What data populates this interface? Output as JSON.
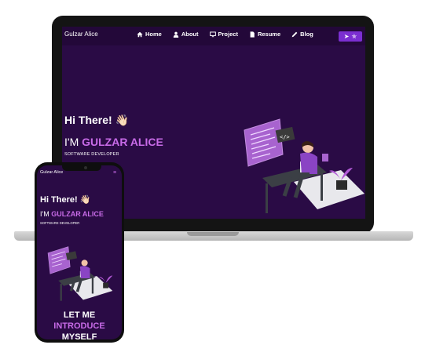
{
  "laptop": {
    "brand": "Gulzar Alice",
    "nav": [
      {
        "label": "Home",
        "icon": "home-icon"
      },
      {
        "label": "About",
        "icon": "person-icon"
      },
      {
        "label": "Project",
        "icon": "monitor-icon"
      },
      {
        "label": "Resume",
        "icon": "document-icon"
      },
      {
        "label": "Blog",
        "icon": "pen-icon"
      }
    ],
    "toggle_icons": [
      "send-icon",
      "star-icon"
    ],
    "hero": {
      "greeting": "Hi There! 👋🏻",
      "name_prefix": "I'M ",
      "name_highlight": "GULZAR ALICE",
      "role": "SOFTWARE DEVELOPER"
    }
  },
  "phone": {
    "brand": "Gulzar Alice",
    "menu_icon": "hamburger-icon",
    "menu_glyph": "≡",
    "hero": {
      "greeting": "Hi There! 👋🏻",
      "name_prefix": "I'M ",
      "name_highlight": "GULZAR ALICE",
      "role": "SOFTWARE DEVELOPER"
    },
    "cta": {
      "line1": "LET ME",
      "line2": "INTRODUCE",
      "line3": "MYSELF"
    }
  },
  "colors": {
    "background": "#2a0b45",
    "accent": "#c86be8",
    "toggle": "#7b2fd1"
  }
}
